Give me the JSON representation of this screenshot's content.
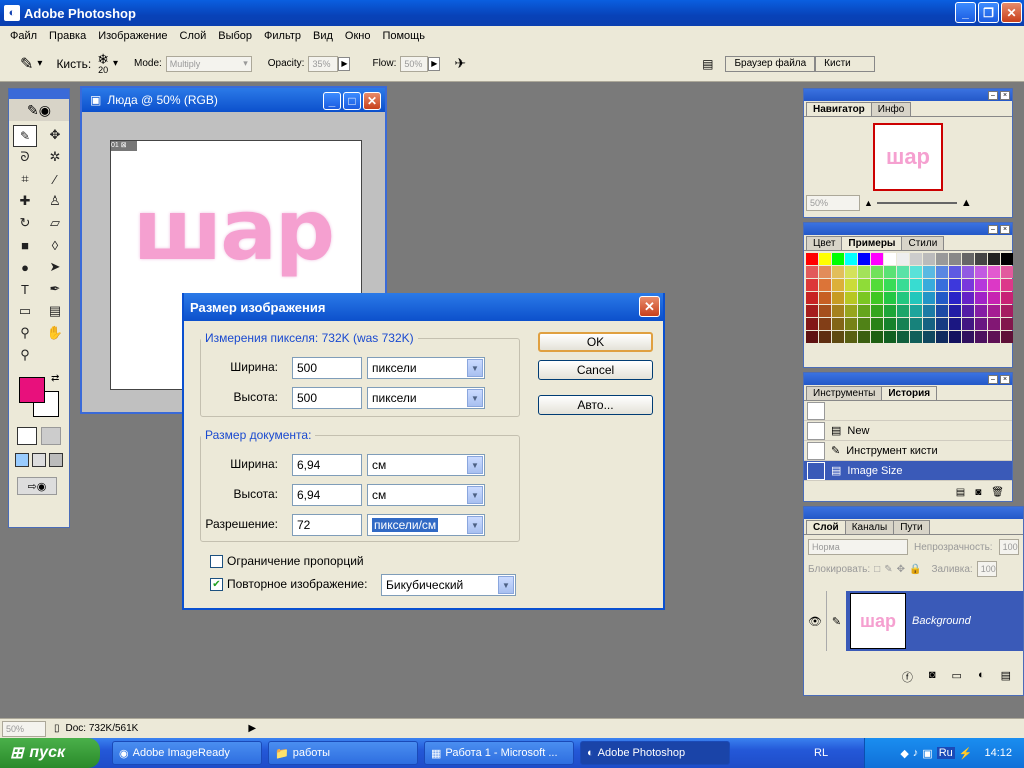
{
  "app": {
    "title": "Adobe Photoshop"
  },
  "menu": [
    "Файл",
    "Правка",
    "Изображение",
    "Слой",
    "Выбор",
    "Фильтр",
    "Вид",
    "Окно",
    "Помощь"
  ],
  "options": {
    "brush_label": "Кисть:",
    "brush_size": "20",
    "mode_label": "Mode:",
    "mode_value": "Multiply",
    "opacity_label": "Opacity:",
    "opacity_value": "35%",
    "flow_label": "Flow:",
    "flow_value": "50%",
    "tab_file_browser": "Браузер файла",
    "tab_brushes": "Кисти"
  },
  "document": {
    "title": "Люда @ 50% (RGB)",
    "drawing_text": "шар"
  },
  "dialog": {
    "title": "Размер изображения",
    "pixel_group": "Измерения пикселя:  732K (was 732K)",
    "width_label": "Ширина:",
    "height_label": "Высота:",
    "px_width": "500",
    "px_height": "500",
    "px_unit": "пиксели",
    "doc_group": "Размер документа:",
    "doc_width": "6,94",
    "doc_height": "6,94",
    "doc_unit": "см",
    "resolution_label": "Разрешение:",
    "resolution": "72",
    "res_unit": "пиксели/см",
    "constrain_label": "Ограничение пропорций",
    "resample_label": "Повторное изображение:",
    "resample_method": "Бикубический",
    "ok": "OK",
    "cancel": "Cancel",
    "auto": "Авто..."
  },
  "navigator": {
    "tab_nav": "Навигатор",
    "tab_info": "Инфо",
    "zoom": "50%"
  },
  "color_panel": {
    "tab_color": "Цвет",
    "tab_swatches": "Примеры",
    "tab_styles": "Стили"
  },
  "history": {
    "tab_tools": "Инструменты",
    "tab_history": "История",
    "items": [
      "New",
      "Инструмент кисти",
      "Image Size"
    ]
  },
  "layers": {
    "tab_layers": "Слой",
    "tab_channels": "Каналы",
    "tab_paths": "Пути",
    "blend": "Норма",
    "opacity_label": "Непрозрачность:",
    "opacity": "100",
    "lock_label": "Блокировать:",
    "fill_label": "Заливка:",
    "fill": "100",
    "layer_name": "Background"
  },
  "status": {
    "zoom": "50%",
    "doc": "Doc: 732K/561K"
  },
  "taskbar": {
    "start": "пуск",
    "tasks": [
      "Adobe ImageReady",
      "работы",
      "Работа 1 - Microsoft ...",
      "Adobe Photoshop"
    ],
    "lang": "RL",
    "lang2": "Ru",
    "time": "14:12"
  },
  "colors": {
    "foreground": "#e8107c",
    "background": "#ffffff",
    "brush_stroke": "#f5a0d0"
  }
}
